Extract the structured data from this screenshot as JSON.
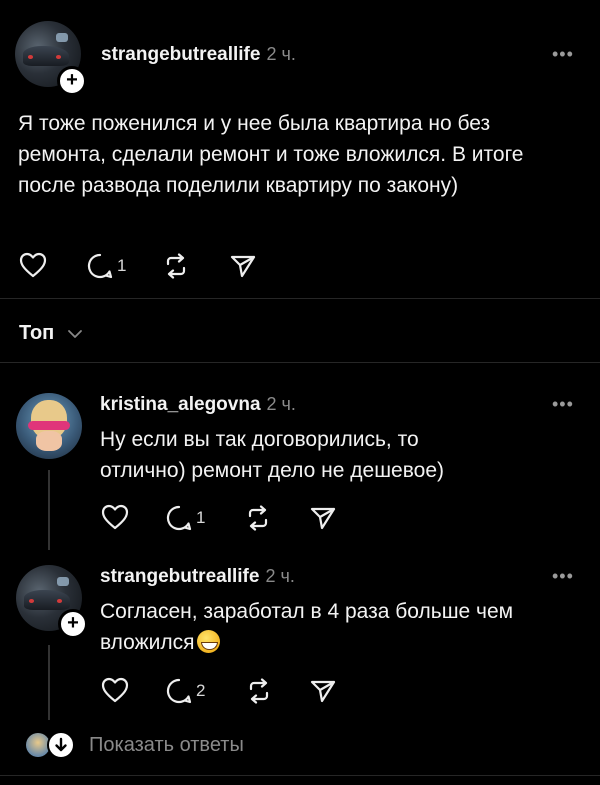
{
  "post": {
    "username": "strangebutreallife",
    "time": "2 ч.",
    "text": "Я тоже поженился и у нее была квартира но без ремонта, сделали ремонт и тоже вложился. В итоге после развода поделили квартиру по закону)",
    "reply_count": "1"
  },
  "sort": {
    "label": "Топ"
  },
  "reply1": {
    "username": "kristina_alegovna",
    "time": "2 ч.",
    "text": "Ну если вы так договорились, то отлично) ремонт дело не дешевое)",
    "reply_count": "1"
  },
  "reply2": {
    "username": "strangebutreallife",
    "time": "2 ч.",
    "text_line1": "Согласен, заработал в 4 раза больше чем",
    "text_line2": "вложился",
    "emoji": "grinning-face",
    "reply_count": "2"
  },
  "show_replies": {
    "label": "Показать ответы"
  },
  "icons": {
    "like": "heart-icon",
    "comment": "comment-icon",
    "repost": "repost-icon",
    "share": "send-icon",
    "more": "more-icon",
    "follow": "plus-icon",
    "chevron": "chevron-down-icon",
    "arrow": "arrow-down-icon"
  }
}
